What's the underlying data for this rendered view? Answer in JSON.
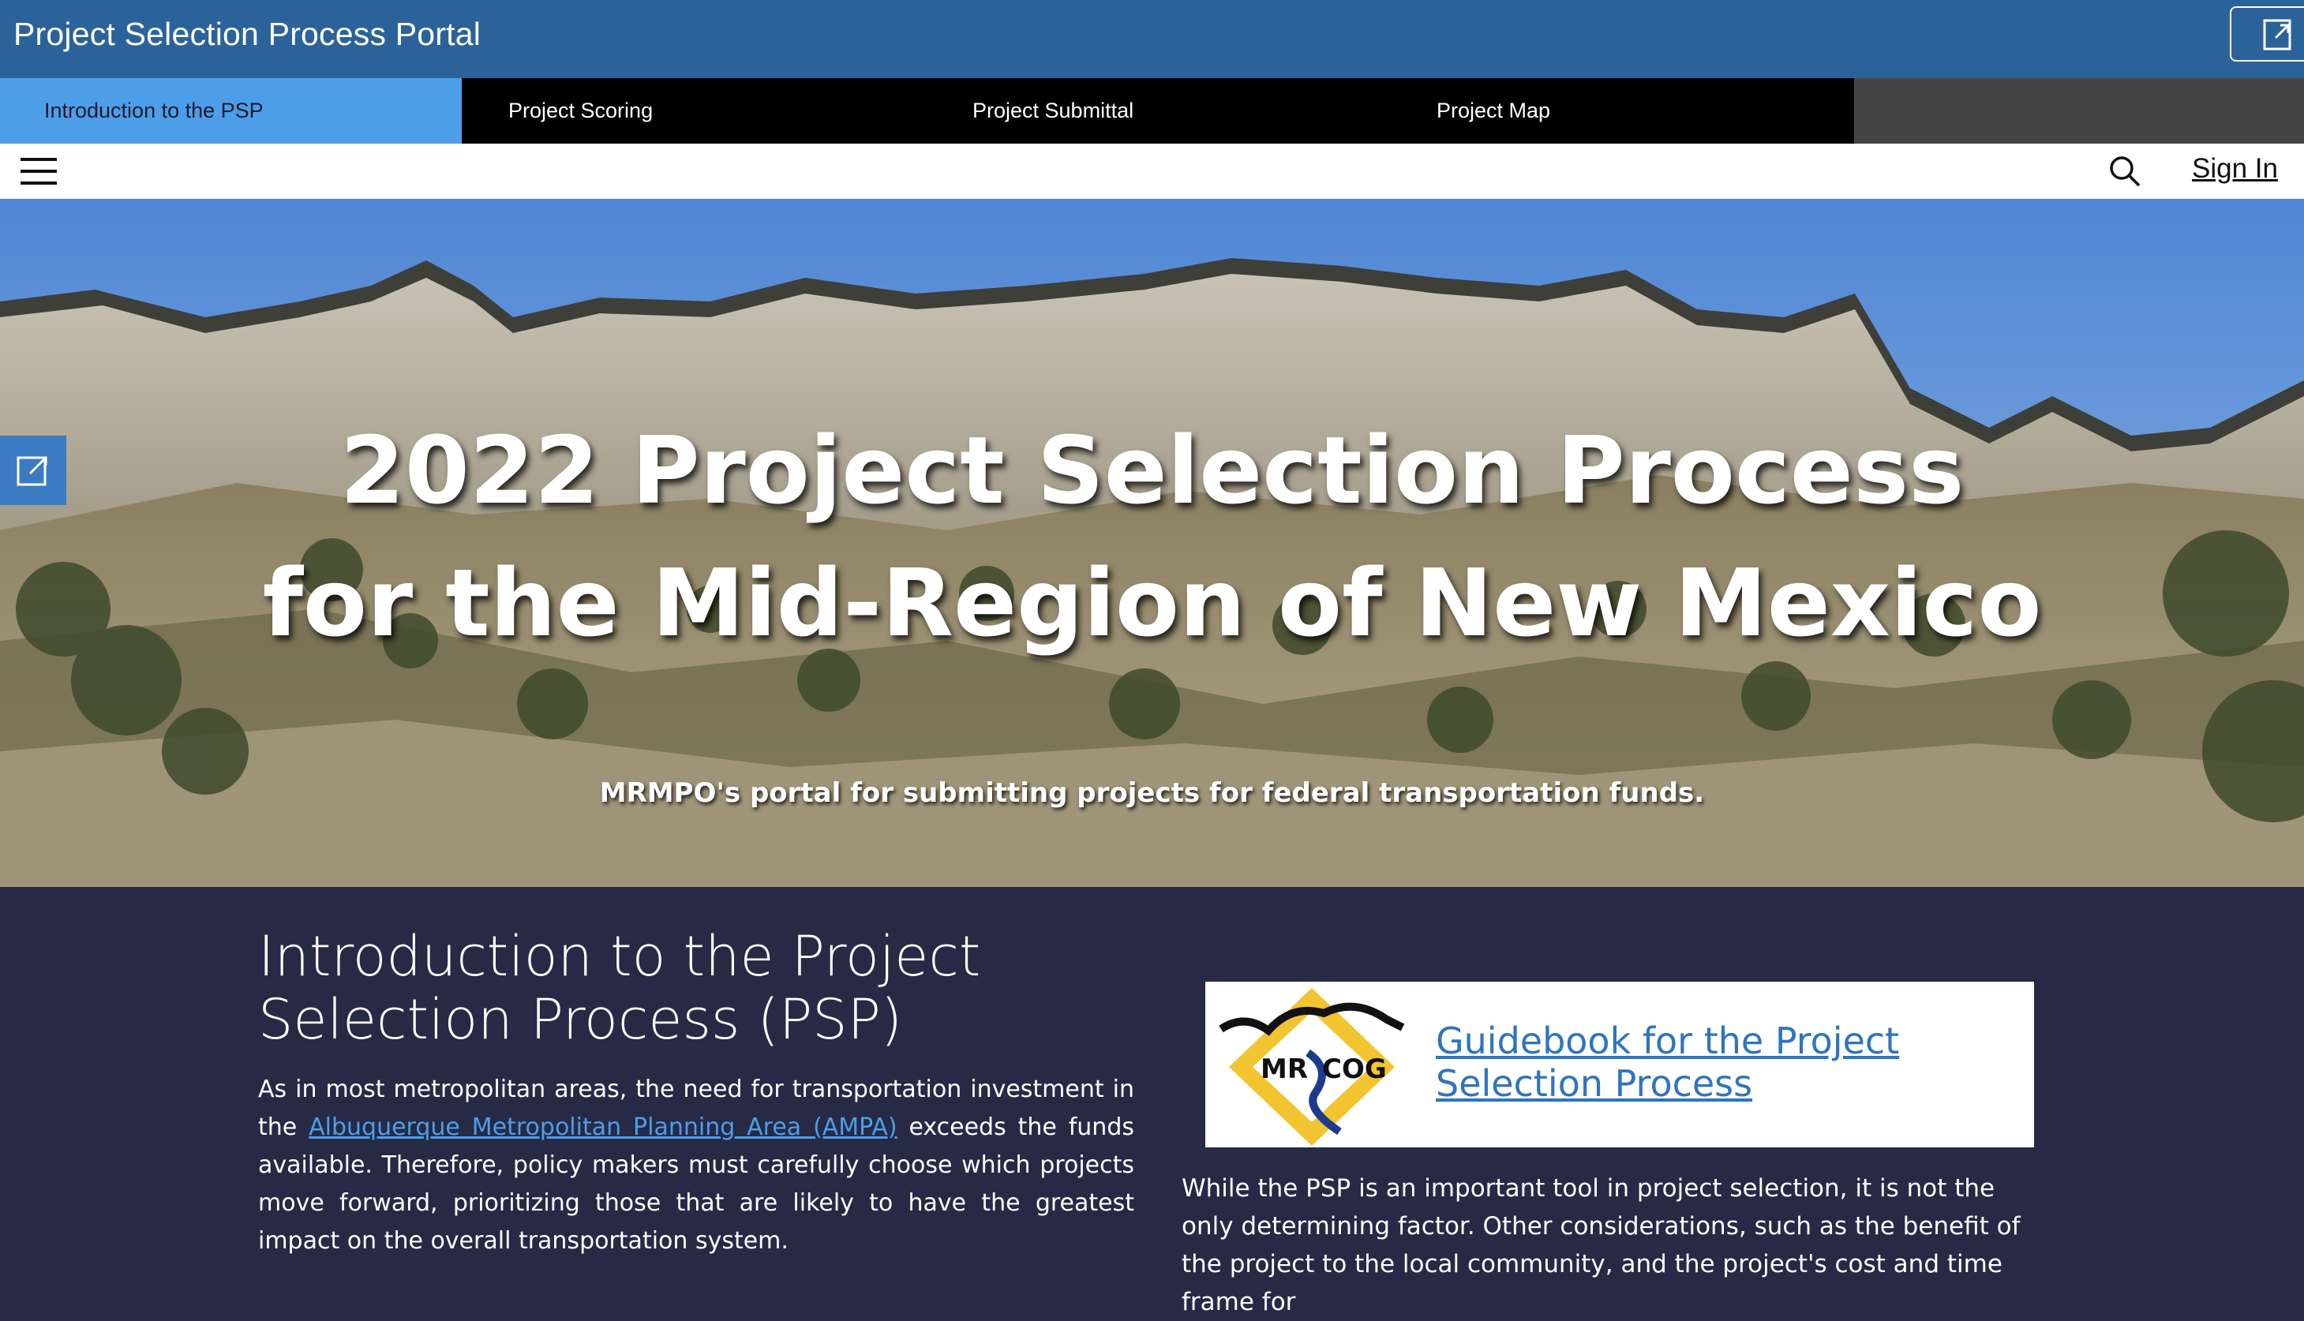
{
  "app": {
    "title": "Project Selection Process Portal"
  },
  "tabs": [
    {
      "label": "Introduction to the PSP",
      "active": true
    },
    {
      "label": "Project Scoring",
      "active": false
    },
    {
      "label": "Project Submittal",
      "active": false
    },
    {
      "label": "Project Map",
      "active": false
    }
  ],
  "utility": {
    "sign_in": "Sign In"
  },
  "hero": {
    "title_line1": "2022 Project Selection Process",
    "title_line2": "for the Mid-Region of New Mexico",
    "subtitle": "MRMPO's portal for submitting projects for federal transportation funds."
  },
  "intro": {
    "heading_line1": "Introduction to the Project",
    "heading_line2": "Selection Process (PSP)",
    "body_prefix": "As in most metropolitan areas, the need for transportation investment in the ",
    "body_link": "Albuquerque Metropolitan Planning Area (AMPA)",
    "body_suffix": " exceeds the funds available. Therefore, policy makers must carefully choose which projects move forward, prioritizing those that are likely to have the greatest impact on the overall transportation system."
  },
  "guidebook": {
    "logo_text_left": "MR",
    "logo_text_right": "COG",
    "link_line1": "Guidebook for the Project",
    "link_line2": "Selection Process"
  },
  "right_body": "While the PSP is an important tool in project selection, it is not the only determining factor. Other considerations, such as the benefit of the project to the local community,  and the project's cost and time frame for",
  "colors": {
    "titlebar": "#2b6299",
    "tab_active": "#4d9ee9",
    "tab_dark": "#000000",
    "content_bg": "#262a45",
    "link": "#2f74c0"
  },
  "icons": [
    "share-icon",
    "menu-icon",
    "search-icon"
  ]
}
